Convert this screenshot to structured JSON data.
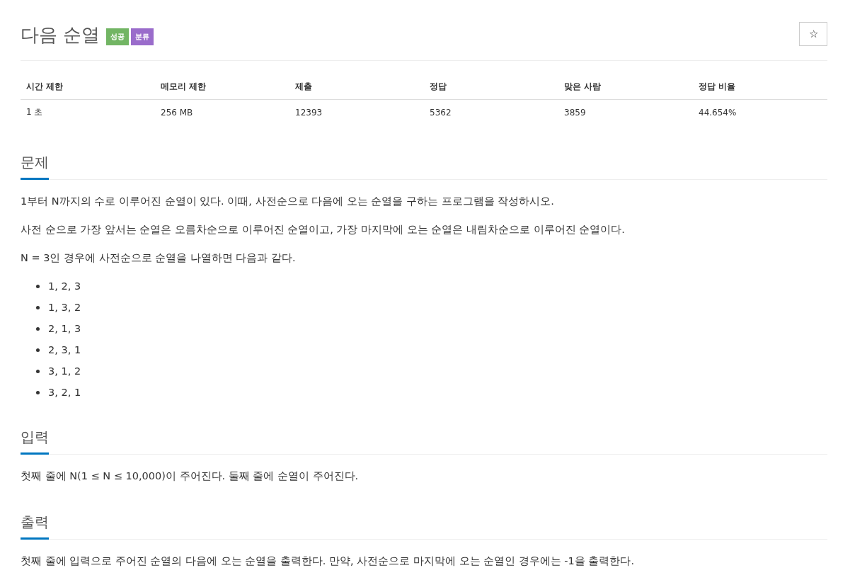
{
  "title": "다음 순열",
  "badges": [
    {
      "label": "성공",
      "color": "#72b564"
    },
    {
      "label": "분류",
      "color": "#9a6ccb"
    }
  ],
  "star_button": {
    "label": "☆"
  },
  "stats": {
    "columns": [
      "시간 제한",
      "메모리 제한",
      "제출",
      "정답",
      "맞은 사람",
      "정답 비율"
    ],
    "rows": [
      [
        "1 초",
        "256 MB",
        "12393",
        "5362",
        "3859",
        "44.654%"
      ]
    ]
  },
  "sections": [
    {
      "heading": "문제",
      "blocks": [
        {
          "kind": "paragraph",
          "text": "1부터 N까지의 수로 이루어진 순열이 있다. 이때, 사전순으로 다음에 오는 순열을 구하는 프로그램을 작성하시오."
        },
        {
          "kind": "paragraph",
          "text": "사전 순으로 가장 앞서는 순열은 오름차순으로 이루어진 순열이고, 가장 마지막에 오는 순열은 내림차순으로 이루어진 순열이다."
        },
        {
          "kind": "paragraph",
          "text": "N = 3인 경우에 사전순으로 순열을 나열하면 다음과 같다."
        },
        {
          "kind": "list",
          "items": [
            "1, 2, 3",
            "1, 3, 2",
            "2, 1, 3",
            "2, 3, 1",
            "3, 1, 2",
            "3, 2, 1"
          ]
        }
      ]
    },
    {
      "heading": "입력",
      "blocks": [
        {
          "kind": "paragraph",
          "text": "첫째 줄에 N(1 ≤ N ≤ 10,000)이 주어진다. 둘째 줄에 순열이 주어진다."
        }
      ]
    },
    {
      "heading": "출력",
      "blocks": [
        {
          "kind": "paragraph",
          "text": "첫째 줄에 입력으로 주어진 순열의 다음에 오는 순열을 출력한다. 만약, 사전순으로 마지막에 오는 순열인 경우에는 -1을 출력한다."
        }
      ]
    }
  ]
}
